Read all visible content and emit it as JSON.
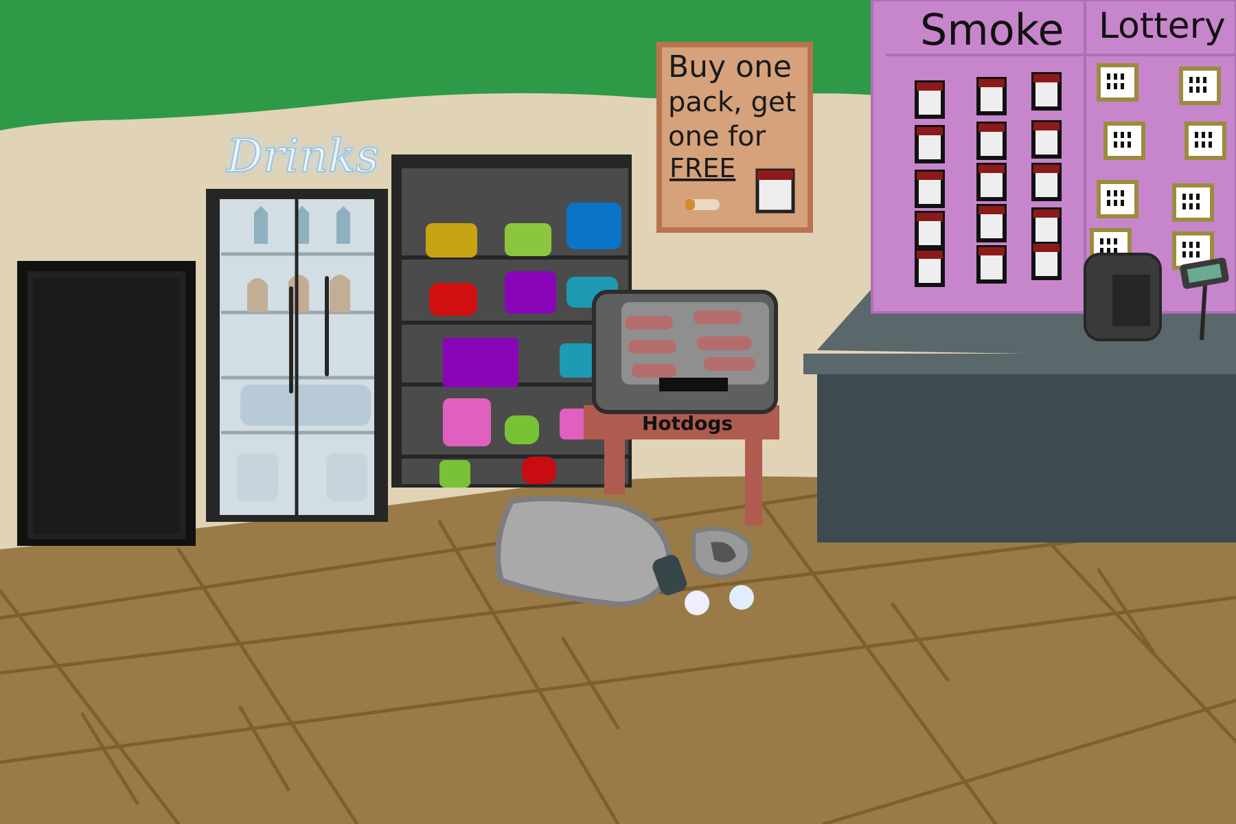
{
  "scene": {
    "drinks_sign": "Drinks",
    "promo_poster": {
      "lines": [
        "Buy one",
        "pack, get",
        "one for",
        "FREE"
      ]
    },
    "hotdog_label": "Hotdogs",
    "smoke_header": "Smoke",
    "lottery_header": "Lottery"
  },
  "colors": {
    "wall_top": "#2e9a48",
    "wall": "#e0d3b6",
    "floor": "#9a7a46",
    "counter": "#3d4a4f",
    "board": "#c785cc"
  }
}
